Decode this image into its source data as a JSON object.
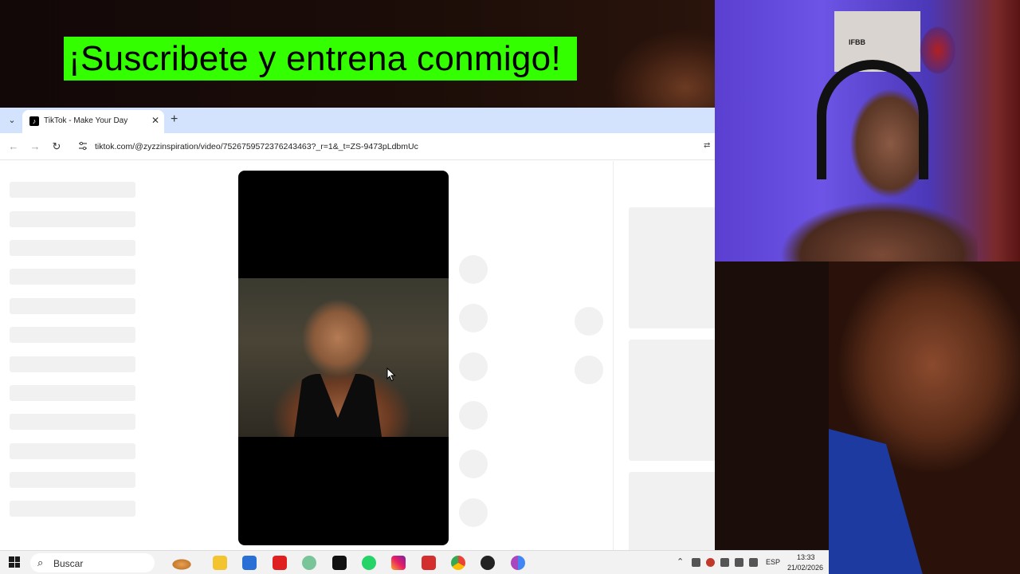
{
  "overlay": {
    "banner_text": "¡Suscribete y entrena conmigo!"
  },
  "browser": {
    "tab_title": "TikTok - Make Your Day",
    "url": "tiktok.com/@zyzzinspiration/video/7526759572376243463?_r=1&_t=ZS-9473pLdbmUc"
  },
  "taskbar": {
    "search_label": "Buscar",
    "apps": [
      "file-explorer",
      "microsoft-store",
      "video-editor",
      "whatsapp-beta",
      "capcut",
      "whatsapp",
      "instagram",
      "recorder",
      "chrome",
      "obs",
      "chrome-profile"
    ],
    "language": "ESP",
    "time": "13:33",
    "date": "21/02/2026"
  },
  "colors": {
    "banner_bg": "#33ff00",
    "tabstrip": "#d3e3fd",
    "skeleton": "#f1f1f1"
  }
}
